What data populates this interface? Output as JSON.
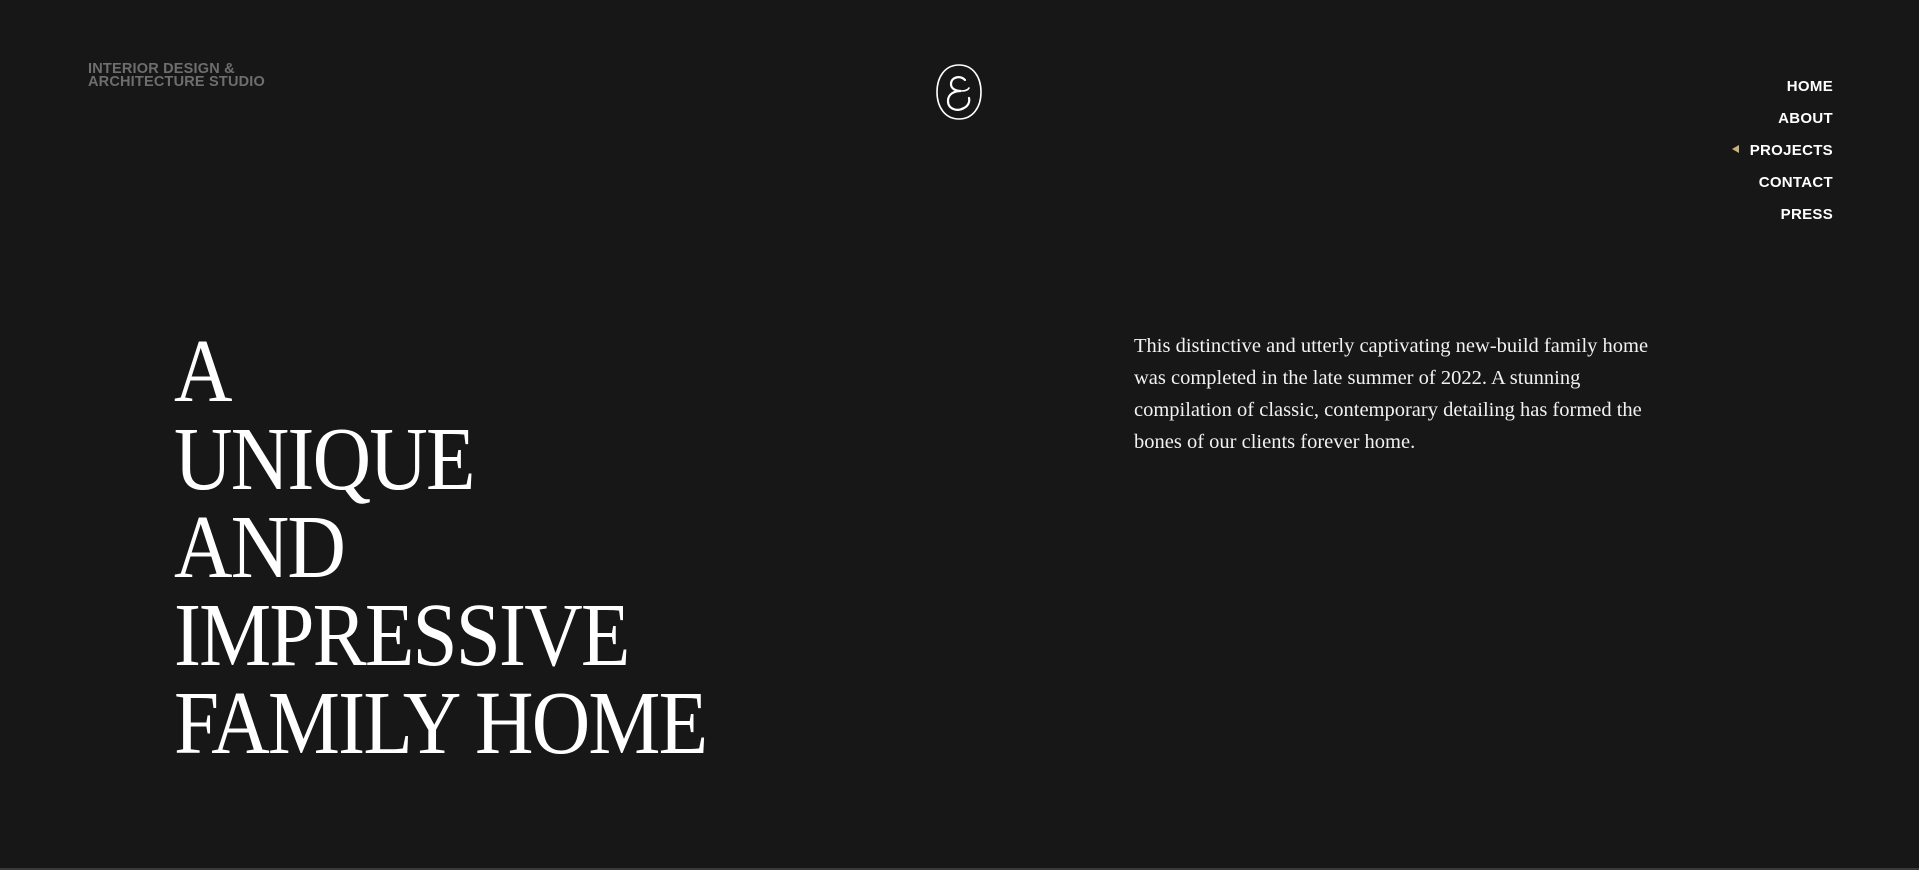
{
  "header": {
    "tagline_line1": "INTERIOR DESIGN &",
    "tagline_line2": "ARCHITECTURE STUDIO",
    "logo_icon": "monogram-logo-icon"
  },
  "nav": {
    "items": [
      {
        "label": "HOME",
        "active": false
      },
      {
        "label": "ABOUT",
        "active": false
      },
      {
        "label": "PROJECTS",
        "active": true
      },
      {
        "label": "CONTACT",
        "active": false
      },
      {
        "label": "PRESS",
        "active": false
      }
    ],
    "active_marker_icon": "arrow-marker-icon",
    "active_marker_color": "#c9b27a"
  },
  "hero": {
    "title_lines": [
      "A",
      "UNIQUE",
      "AND",
      "IMPRESSIVE",
      "FAMILY HOME"
    ]
  },
  "intro": {
    "text": "This distinctive and utterly captivating new-build family home was completed in the late summer of 2022. A stunning compilation of classic, contemporary detailing has formed the bones of our clients forever home."
  },
  "colors": {
    "background": "#171717",
    "text": "#ffffff",
    "muted_text": "#6e6e6e",
    "accent": "#c9b27a"
  }
}
